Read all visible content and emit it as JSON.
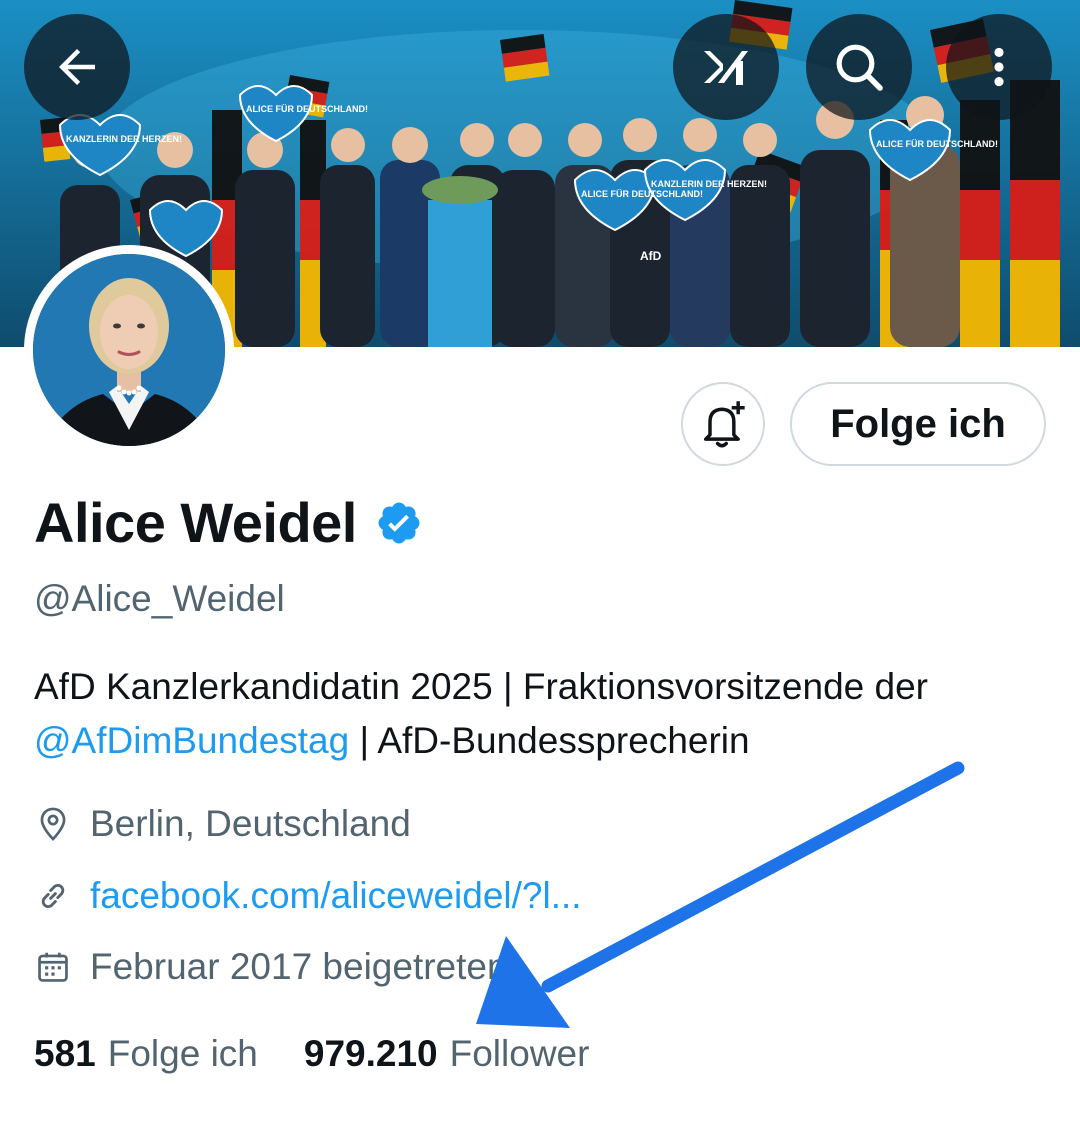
{
  "header": {
    "back_icon": "arrow-left-icon",
    "grok_icon": "grok-icon",
    "search_icon": "search-icon",
    "more_icon": "more-vertical-icon",
    "banner_texts": [
      "ALICE FÜR DEUTSCHLAND!",
      "KANZLERIN DER HERZEN!",
      "AfD"
    ]
  },
  "profile": {
    "display_name": "Alice Weidel",
    "verified": true,
    "handle": "@Alice_Weidel",
    "bio_part1": "AfD Kanzlerkandidatin 2025 |  Fraktionsvorsitzende der ",
    "bio_mention": "@AfDimBundestag",
    "bio_part2": " | AfD-Bundessprecherin",
    "location": "Berlin, Deutschland",
    "website": "facebook.com/aliceweidel/?l...",
    "joined": "Februar 2017 beigetreten"
  },
  "actions": {
    "notify_icon": "bell-plus-icon",
    "follow_label": "Folge ich"
  },
  "stats": {
    "following_count": "581",
    "following_label": "Folge ich",
    "followers_count": "979.210",
    "followers_label": "Follower"
  },
  "colors": {
    "accent": "#1d9bf0",
    "secondary_text": "#536471",
    "annotation_arrow": "#1f73e8"
  }
}
